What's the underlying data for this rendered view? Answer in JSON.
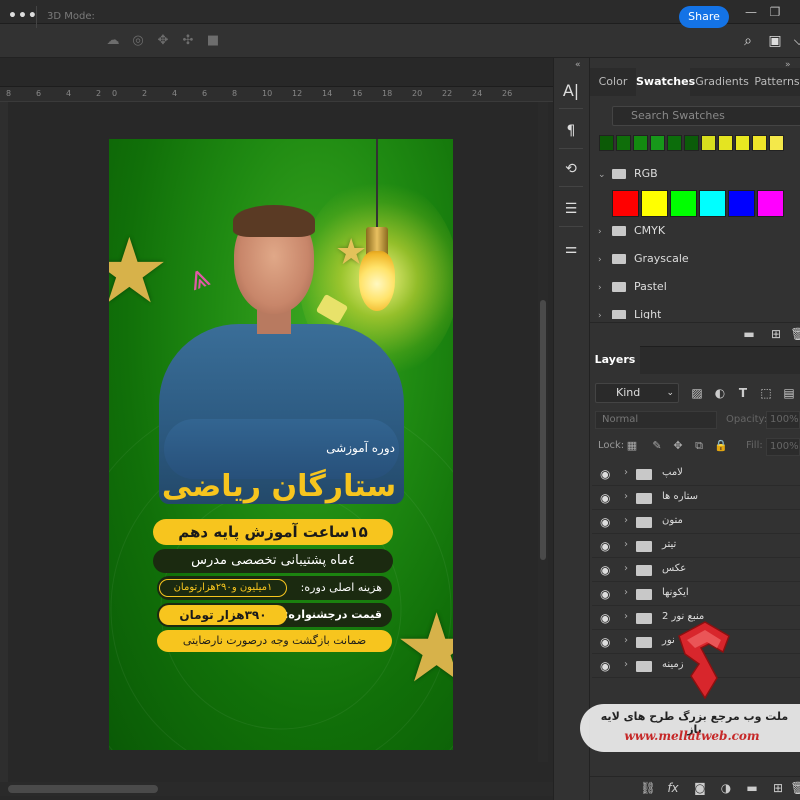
{
  "window": {
    "min_glyph": "—",
    "restore_glyph": "❐"
  },
  "options": {
    "mode_label": "3D Mode:",
    "share_label": "Share",
    "more_glyph": "•••"
  },
  "ruler": {
    "ticks": [
      "8",
      "6",
      "4",
      "2",
      "0",
      "2",
      "4",
      "6",
      "8",
      "10",
      "12",
      "14",
      "16",
      "18",
      "20",
      "22",
      "24",
      "26"
    ]
  },
  "artwork": {
    "subtitle": "دوره آموزشی",
    "title": "ستارگان ریاضی",
    "line1": "۱۵ساعت آموزش پایه دهم",
    "line2": "٤ماه پشتیبانی تخصصی مدرس",
    "line3_label": "هزینه اصلی دوره:",
    "line3_value": "۱میلیون و۲۹۰هزارتومان",
    "line4_label": "قیمت درجشنواره:",
    "line4_value": "۳۹۰هزار تومان",
    "line5": "ضمانت بازگشت وجه درصورت نارضایتی",
    "colors": {
      "green": "#1f8a12",
      "yellow": "#f7c51e",
      "dark": "#1b2a10"
    }
  },
  "swatches": {
    "tabs": [
      "Color",
      "Swatches",
      "Gradients",
      "Patterns"
    ],
    "active_tab": "Swatches",
    "search_placeholder": "Search Swatches",
    "recent_colors": [
      "#0c5a06",
      "#0f6e0a",
      "#138a10",
      "#17981a",
      "#0c6d0b",
      "#0b5c09",
      "#d8de1e",
      "#e4e421",
      "#e8e821",
      "#efe529",
      "#f4e84a"
    ],
    "groups": [
      "RGB",
      "CMYK",
      "Grayscale",
      "Pastel",
      "Light"
    ],
    "rgb_colors": [
      "#ff0000",
      "#ffff00",
      "#00ff00",
      "#00ffff",
      "#0000ff",
      "#ff00ff"
    ]
  },
  "layers": {
    "tab_label": "Layers",
    "kind_label": "Kind",
    "blend_mode": "Normal",
    "opacity_label": "Opacity:",
    "opacity_value": "100%",
    "lock_label": "Lock:",
    "fill_label": "Fill:",
    "fill_value": "100%",
    "items": [
      "لامپ",
      "ستاره ها",
      "متون",
      "تیتر",
      "عکس",
      "ایکونها",
      "منبع نور 2",
      "نور",
      "زمینه"
    ]
  },
  "watermark": {
    "line1": "ملت وب مرجع بزرگ طرح های لایه باز",
    "line2": "www.mellatweb.com"
  }
}
